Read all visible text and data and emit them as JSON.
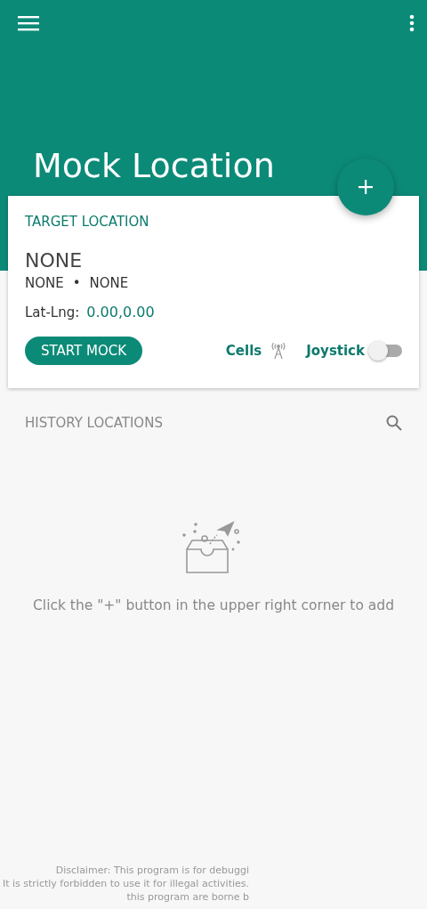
{
  "app_bar": {
    "title": "Mock Location"
  },
  "target": {
    "heading": "TARGET LOCATION",
    "name": "NONE",
    "region": "NONE",
    "separator": "•",
    "city": "NONE",
    "latlng_label": "Lat-Lng:",
    "latlng_value": "0.00,0.00",
    "start_button": "START MOCK",
    "cells_label": "Cells",
    "joystick_label": "Joystick",
    "joystick_on": false
  },
  "history": {
    "heading": "HISTORY LOCATIONS",
    "empty_message": "Click the \"+\" button in the upper right corner to add"
  },
  "disclaimer": [
    "Disclaimer: This program is for debuggi",
    "It is strictly forbidden to use it for illegal activities.",
    "this program are borne b"
  ]
}
